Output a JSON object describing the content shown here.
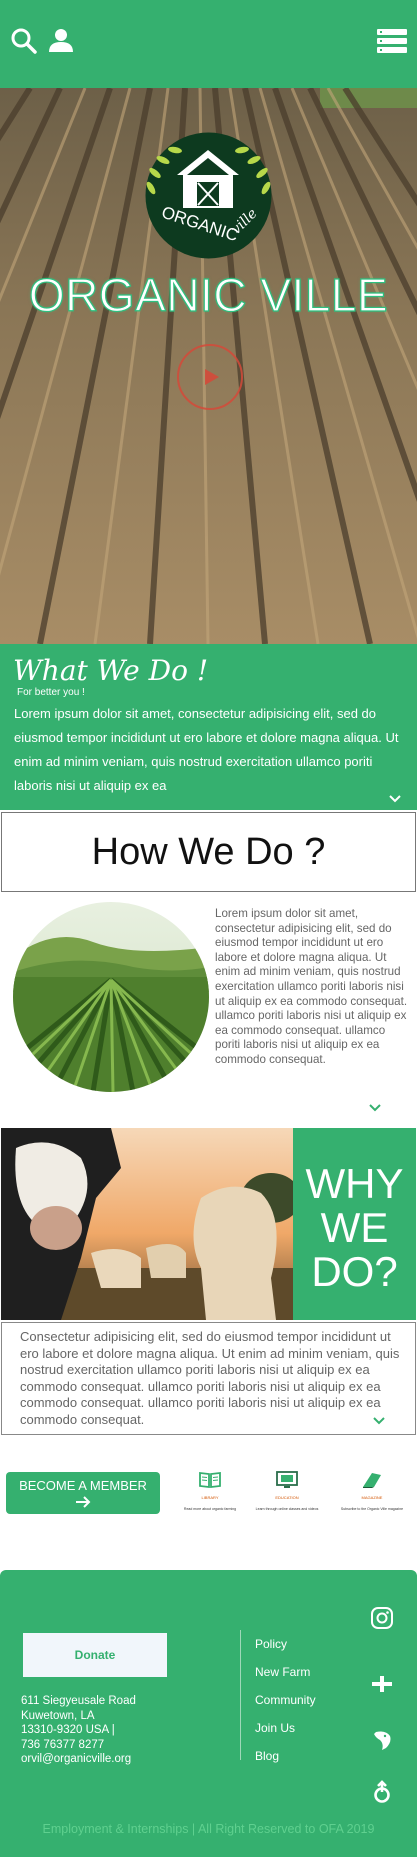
{
  "header": {
    "search_icon": "search-icon",
    "user_icon": "user-icon",
    "menu_icon": "menu-icon"
  },
  "hero": {
    "logo_text_primary": "ORGANIC",
    "logo_text_secondary": "ville",
    "title": "ORGANIC VILLE",
    "play_icon": "play-icon"
  },
  "what_we_do": {
    "heading": "What We Do !",
    "subheading": "For better you !",
    "body": "Lorem ipsum dolor sit amet, consectetur adipisicing elit, sed do eiusmod tempor incididunt ut ero labore et dolore magna aliqua. Ut enim ad minim veniam, quis nostrud exercitation ullamco poriti laboris nisi ut aliquip ex ea"
  },
  "how_we_do": {
    "heading": "How We Do ?",
    "body": "Lorem ipsum dolor sit amet, consectetur adipisicing elit, sed do eiusmod tempor incididunt ut ero labore et dolore magna aliqua. Ut enim ad minim veniam, quis nostrud exercitation ullamco poriti laboris nisi ut aliquip ex ea commodo consequat. ullamco poriti laboris nisi ut aliquip ex ea commodo consequat. ullamco poriti laboris nisi ut aliquip ex ea commodo consequat."
  },
  "why_we_do": {
    "heading_line1": "WHY",
    "heading_line2": "WE",
    "heading_line3": "DO?",
    "body": "Consectetur adipisicing elit, sed do eiusmod tempor incididunt ut ero labore et dolore magna aliqua. Ut enim ad minim veniam, quis nostrud exercitation ullamco poriti laboris nisi ut aliquip ex ea commodo consequat. ullamco poriti laboris nisi ut aliquip ex ea commodo consequat. ullamco poriti laboris nisi ut aliquip ex ea commodo consequat."
  },
  "member": {
    "button_label": "BECOME A MEMBER",
    "features": [
      {
        "icon": "book-icon",
        "title": "LIBRARY",
        "desc": "Read more about organic farming"
      },
      {
        "icon": "monitor-icon",
        "title": "EDUCATION",
        "desc": "Learn through online classes and videos"
      },
      {
        "icon": "magazine-icon",
        "title": "MAGAZINE",
        "desc": "Subscribe to the Organic Ville magazine"
      }
    ]
  },
  "footer": {
    "donate_label": "Donate",
    "address_lines": [
      "611 Siegyeusale Road",
      "Kuwetown, LA",
      "13310-9320 USA |",
      "736 76377 8277",
      "orvil@organicville.org"
    ],
    "links": [
      "Policy",
      "New Farm",
      "Community",
      "Join Us",
      "Blog"
    ],
    "social_icons": [
      "instagram-icon",
      "plus-brand-icon",
      "bird-icon",
      "share-icon"
    ],
    "copyright": "Employment & Internships | All Right Reserved to OFA 2019"
  },
  "colors": {
    "brand_green": "#35b06f",
    "logo_dark": "#0d3a1f",
    "accent_orange": "#d35400"
  }
}
